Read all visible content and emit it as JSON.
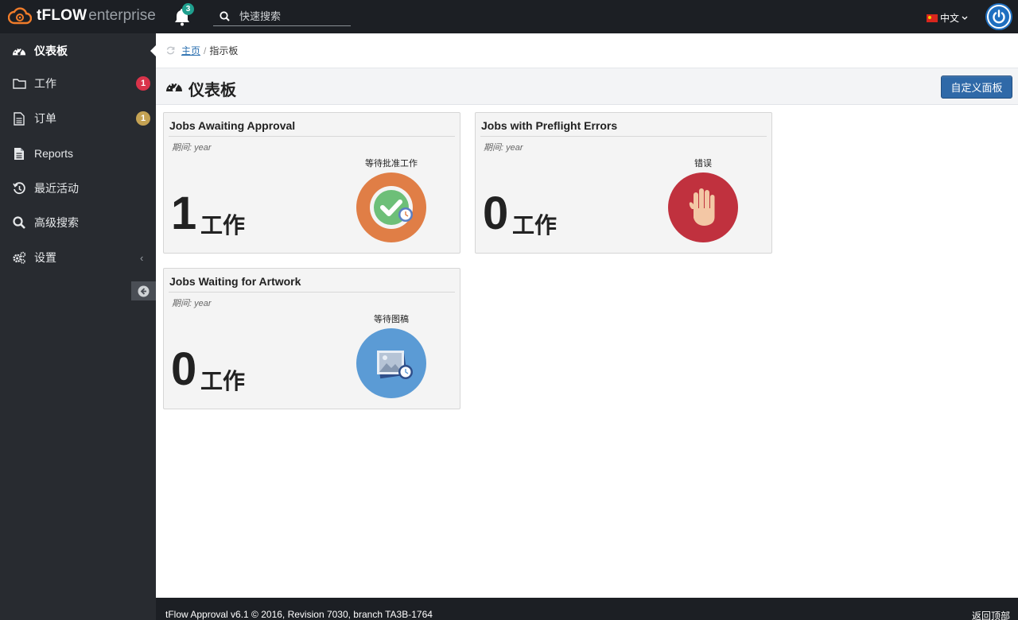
{
  "header": {
    "brand": "tFLOW",
    "brand_suffix": "enterprise",
    "notification_count": "3",
    "search_placeholder": "快速搜索",
    "language": "中文",
    "colors": {
      "topbar": "#1c1f24",
      "accent": "#1f6fc0"
    }
  },
  "sidebar": {
    "items": [
      {
        "label": "仪表板",
        "icon": "dashboard-icon",
        "active": true
      },
      {
        "label": "工作",
        "icon": "folder-icon",
        "badge": "1"
      },
      {
        "label": "订单",
        "icon": "file-icon",
        "badge": "1"
      },
      {
        "label": "Reports",
        "icon": "report-icon"
      },
      {
        "label": "最近活动",
        "icon": "history-icon"
      },
      {
        "label": "高级搜索",
        "icon": "search-icon"
      },
      {
        "label": "设置",
        "icon": "gears-icon"
      }
    ]
  },
  "breadcrumb": {
    "home": "主页",
    "separator": "/",
    "current": "指示板"
  },
  "page": {
    "title": "仪表板",
    "action_button": "自定义面板"
  },
  "cards": [
    {
      "title": "Jobs Awaiting Approval",
      "period": "期间: year",
      "count": "1",
      "unit": "工作",
      "status_label": "等待批准工作",
      "icon": "approval-check-icon",
      "color": "#e07e46"
    },
    {
      "title": "Jobs with Preflight Errors",
      "period": "期间: year",
      "count": "0",
      "unit": "工作",
      "status_label": "错误",
      "icon": "stop-hand-icon",
      "color": "#c0313e"
    },
    {
      "title": "Jobs Waiting for Artwork",
      "period": "期间: year",
      "count": "0",
      "unit": "工作",
      "status_label": "等待图稿",
      "icon": "artwork-image-icon",
      "color": "#5b9bd5"
    }
  ],
  "footer": {
    "text": "tFlow Approval v6.1 © 2016, Revision 7030, branch TA3B-1764",
    "right": "返回顶部"
  }
}
